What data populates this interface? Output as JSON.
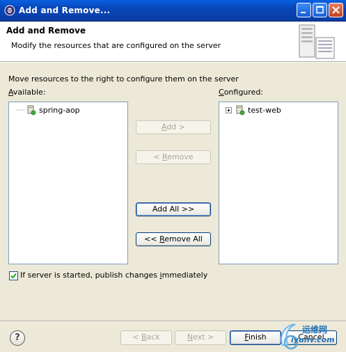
{
  "window": {
    "title": "Add and Remove...",
    "controls": {
      "minimize": "minimize-icon",
      "maximize": "maximize-icon",
      "close": "close-icon"
    }
  },
  "header": {
    "title": "Add and Remove",
    "description": "Modify the resources that are configured on the server",
    "icon": "server-icon"
  },
  "body": {
    "instruction": "Move resources to the right to configure them on the server",
    "available_label_key": "A",
    "available_label_rest": "vailable:",
    "configured_label_key": "C",
    "configured_label_rest": "onfigured:",
    "available_items": [
      {
        "label": "spring-aop",
        "icon": "project-icon"
      }
    ],
    "configured_items": [
      {
        "label": "test-web",
        "icon": "project-icon",
        "expander": "+"
      }
    ],
    "buttons": {
      "add": {
        "pre": "",
        "key": "A",
        "post": "dd >"
      },
      "remove": {
        "pre": "< ",
        "key": "R",
        "post": "emove"
      },
      "add_all": {
        "pre": "Add All >>",
        "key": "",
        "post": ""
      },
      "remove_all": {
        "pre": "<< ",
        "key": "R",
        "post": "emove All"
      }
    },
    "publish_checkbox": {
      "checked": true,
      "label_pre": "If server is started, publish changes ",
      "label_key": "i",
      "label_post": "mmediately"
    }
  },
  "footer": {
    "help": "?",
    "back": {
      "pre": "< ",
      "key": "B",
      "post": "ack"
    },
    "next": {
      "pre": "",
      "key": "N",
      "post": "ext >"
    },
    "finish": {
      "pre": "",
      "key": "F",
      "post": "inish"
    },
    "cancel": {
      "label": "Cancel"
    }
  },
  "watermark": {
    "line1": "运维网",
    "line2": "iyunv.com"
  },
  "colors": {
    "titlebar": "#0846b8",
    "dialog_bg": "#ece9d8",
    "list_border": "#7f9db9",
    "button_border": "#003c74"
  }
}
